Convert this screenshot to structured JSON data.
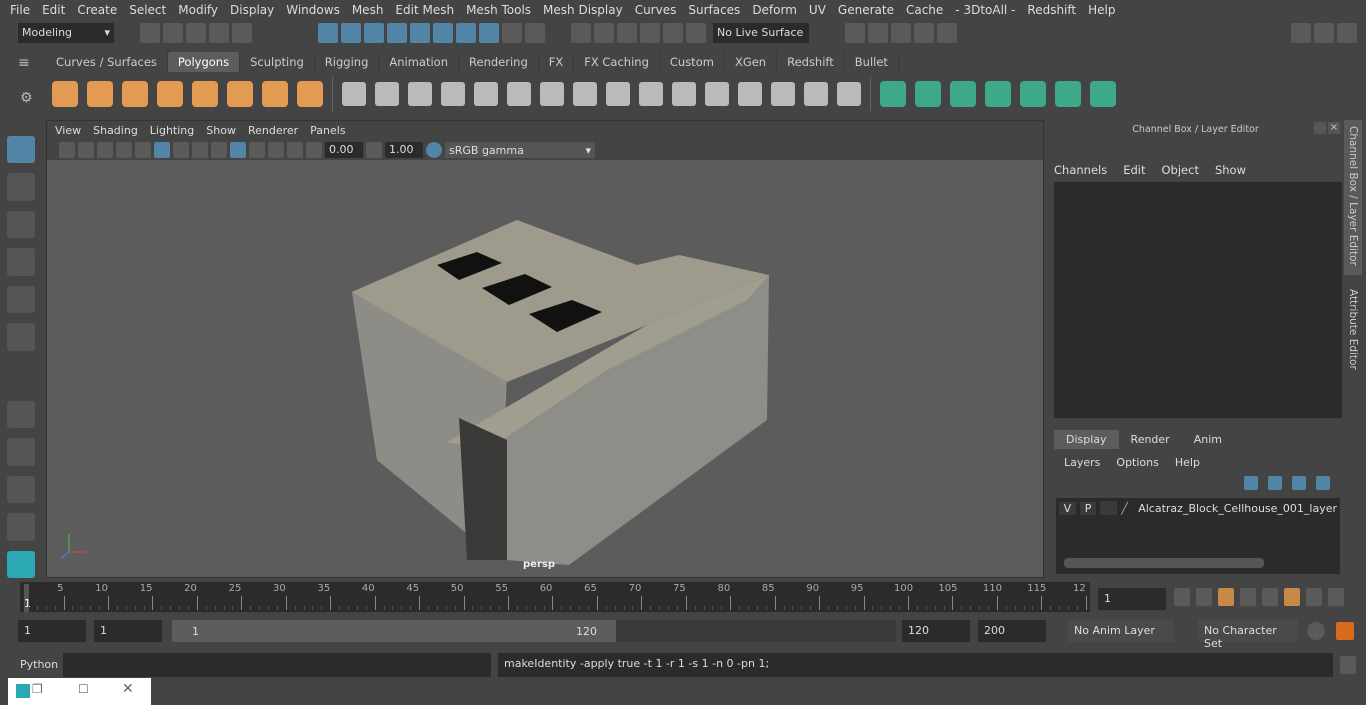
{
  "menubar": [
    "File",
    "Edit",
    "Create",
    "Select",
    "Modify",
    "Display",
    "Windows",
    "Mesh",
    "Edit Mesh",
    "Mesh Tools",
    "Mesh Display",
    "Curves",
    "Surfaces",
    "Deform",
    "UV",
    "Generate",
    "Cache",
    "- 3DtoAll -",
    "Redshift",
    "Help"
  ],
  "toolbar": {
    "mode": "Modeling",
    "live_surface": "No Live Surface"
  },
  "shelf_tabs": [
    "Curves / Surfaces",
    "Polygons",
    "Sculpting",
    "Rigging",
    "Animation",
    "Rendering",
    "FX",
    "FX Caching",
    "Custom",
    "XGen",
    "Redshift",
    "Bullet"
  ],
  "shelf_active": "Polygons",
  "shelf_icons_orange": [
    "sphere-icon",
    "cube-icon",
    "cylinder-icon",
    "cone-icon",
    "plane-icon",
    "torus-icon",
    "pyramid-icon",
    "pipe-icon"
  ],
  "shelf_icons_white": [
    "combine-icon",
    "separate-icon",
    "mirror-icon",
    "smooth-icon",
    "bevel-icon",
    "extrude-icon",
    "bridge-icon",
    "multicut-icon",
    "extrude-face-icon",
    "fill-hole-icon",
    "cube-icon",
    "edge-loop-icon",
    "insert-edge-icon",
    "target-weld-icon",
    "merge-icon",
    "boolean-icon"
  ],
  "shelf_icons_teal": [
    "uv-editor-icon",
    "planar-map-icon",
    "cylindrical-map-icon",
    "automatic-map-icon",
    "unfold-icon",
    "checker-icon",
    "sew-icon"
  ],
  "viewport": {
    "menu": [
      "View",
      "Shading",
      "Lighting",
      "Show",
      "Renderer",
      "Panels"
    ],
    "near": "0.00",
    "far": "1.00",
    "color_space": "sRGB gamma",
    "camera": "persp"
  },
  "right_panel": {
    "title": "Channel Box / Layer Editor",
    "menu": [
      "Channels",
      "Edit",
      "Object",
      "Show"
    ],
    "tabs": [
      "Display",
      "Render",
      "Anim"
    ],
    "layer_menu": [
      "Layers",
      "Options",
      "Help"
    ],
    "layer": {
      "v": "V",
      "p": "P",
      "name": "Alcatraz_Block_Cellhouse_001_layer"
    },
    "vertical_tabs": [
      "Channel Box / Layer Editor",
      "Attribute Editor"
    ]
  },
  "timeline": {
    "ticks": [
      "5",
      "10",
      "15",
      "20",
      "25",
      "30",
      "35",
      "40",
      "45",
      "50",
      "55",
      "60",
      "65",
      "70",
      "75",
      "80",
      "85",
      "90",
      "95",
      "100",
      "105",
      "110",
      "115",
      "12"
    ],
    "start_label": "1",
    "current": "1"
  },
  "range": {
    "start": "1",
    "playback_start": "1",
    "slider_start": "1",
    "slider_end": "120",
    "playback_end": "120",
    "end": "200",
    "anim_layer": "No Anim Layer",
    "char_set": "No Character Set"
  },
  "command": {
    "lang": "Python",
    "result": "makeIdentity -apply true -t 1 -r 1 -s 1 -n 0 -pn 1;"
  },
  "colors": {
    "accent": "#5285a6",
    "shelf_orange": "#e39a52",
    "bg": "#444444",
    "viewport": "#5c5c5c"
  }
}
